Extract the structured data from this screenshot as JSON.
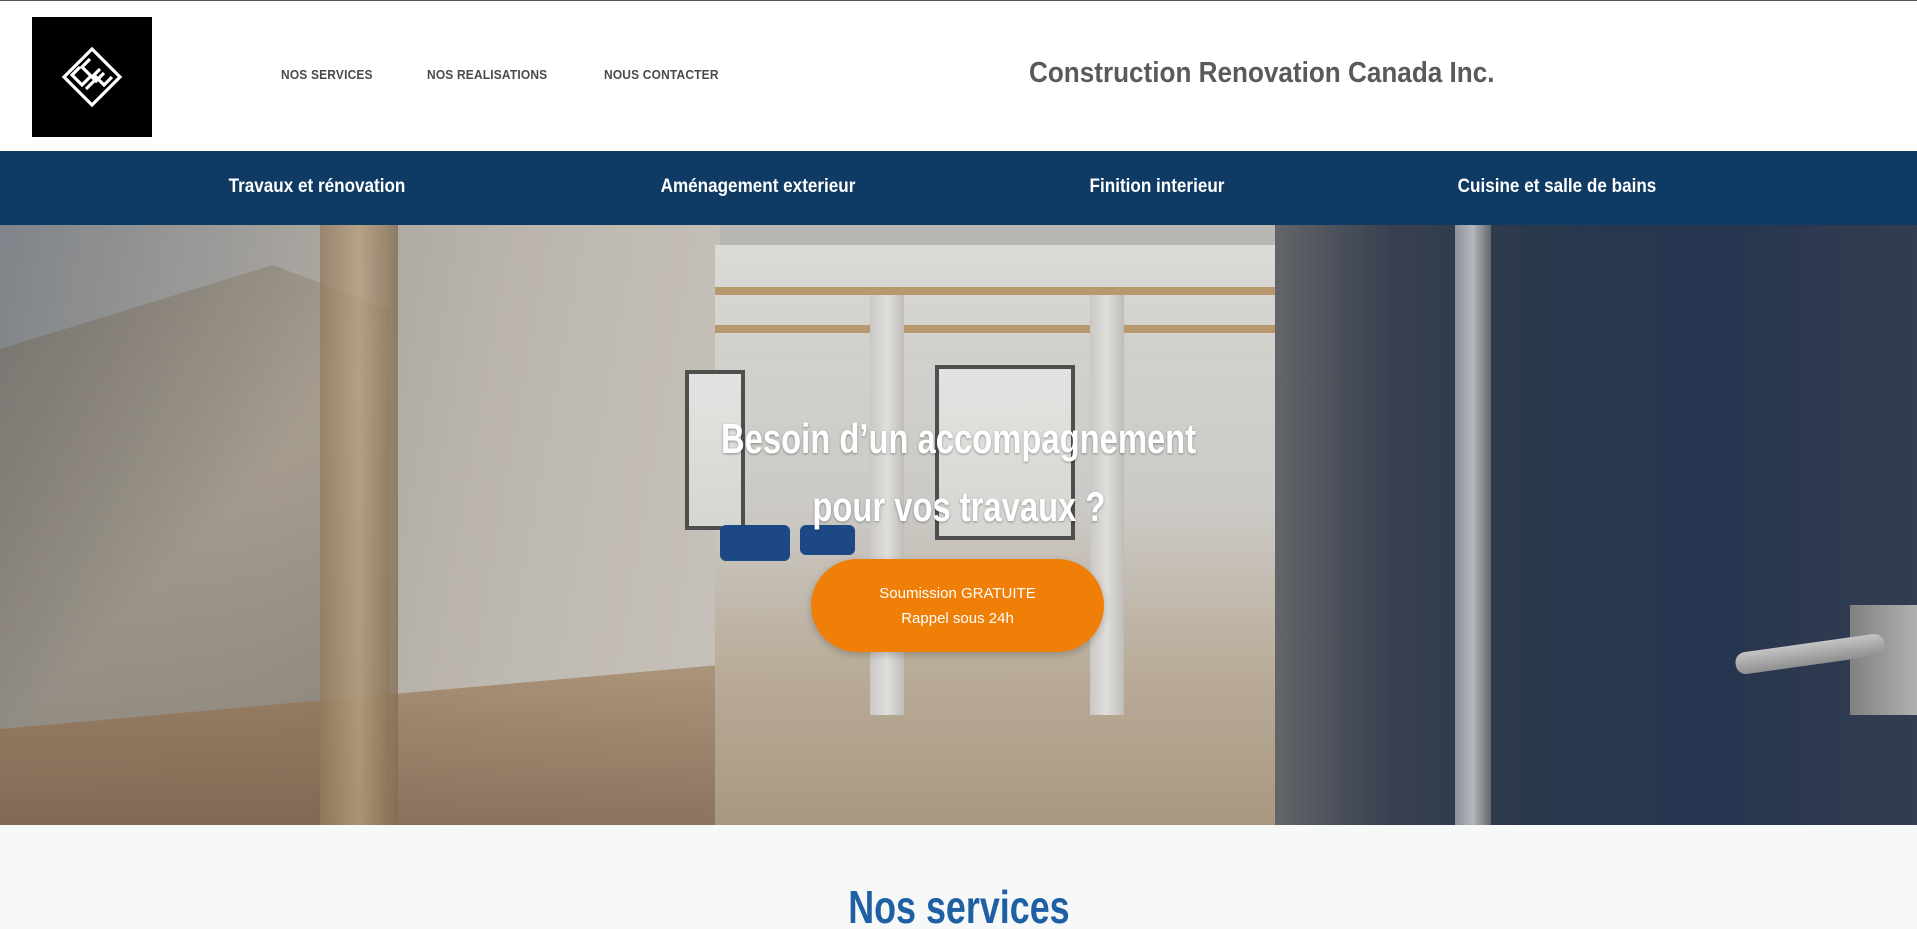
{
  "header": {
    "logo_alt": "CRC",
    "nav": [
      {
        "label": "NOS SERVICES"
      },
      {
        "label": "NOS REALISATIONS"
      },
      {
        "label": "NOUS CONTACTER"
      }
    ],
    "company_name": "Construction Renovation Canada Inc."
  },
  "categories": [
    {
      "label": "Travaux et rénovation"
    },
    {
      "label": "Aménagement exterieur"
    },
    {
      "label": "Finition interieur"
    },
    {
      "label": "Cuisine et salle de bains"
    }
  ],
  "hero": {
    "title_line1": "Besoin d’un accompagnement",
    "title_line2": "pour vos travaux ?",
    "cta_line1": "Soumission GRATUITE",
    "cta_line2": "Rappel sous 24h"
  },
  "services": {
    "title": "Nos services"
  },
  "colors": {
    "category_bar": "#0f3a63",
    "cta": "#f07f07",
    "services_title": "#1f5fa3",
    "logo_background": "#000000"
  }
}
